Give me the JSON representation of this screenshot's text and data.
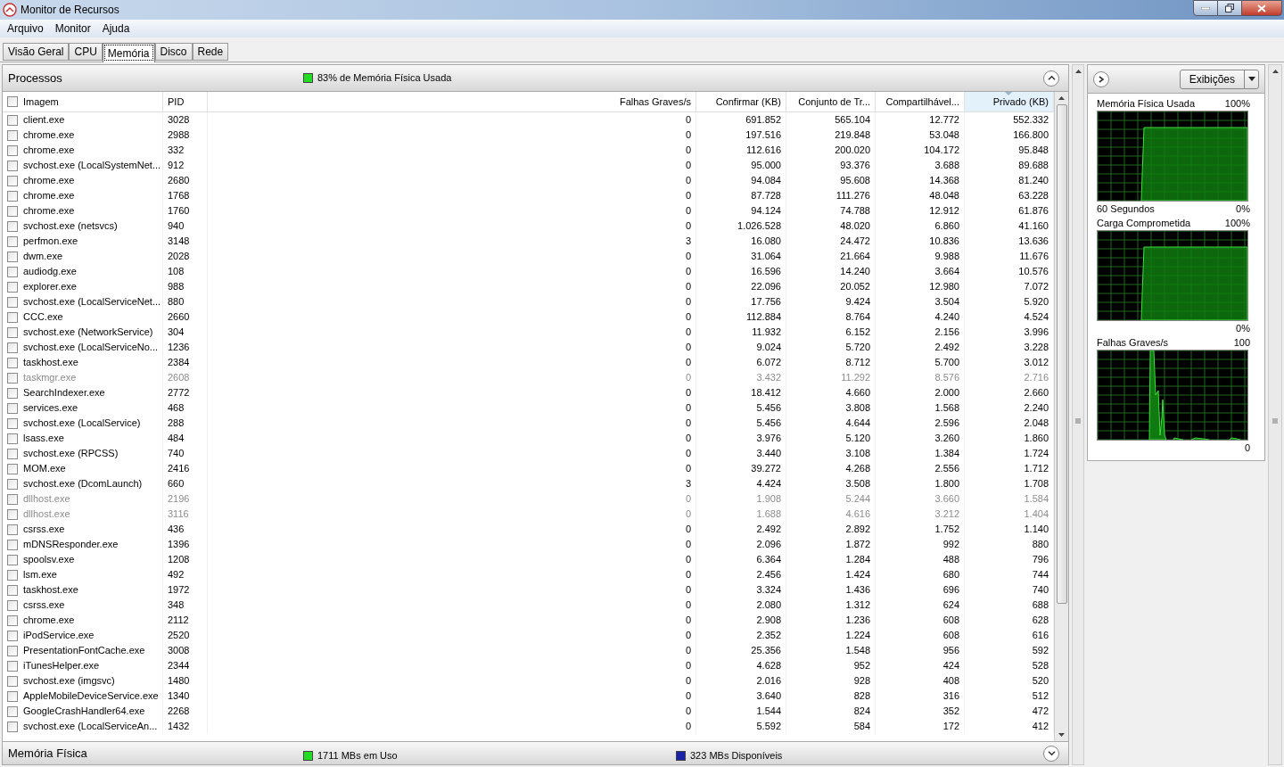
{
  "window": {
    "title": "Monitor de Recursos"
  },
  "menu": [
    {
      "label": "Arquivo"
    },
    {
      "label": "Monitor"
    },
    {
      "label": "Ajuda"
    }
  ],
  "tabs": [
    {
      "label": "Visão Geral",
      "selected": false
    },
    {
      "label": "CPU",
      "selected": false
    },
    {
      "label": "Memória",
      "selected": true
    },
    {
      "label": "Disco",
      "selected": false
    },
    {
      "label": "Rede",
      "selected": false
    }
  ],
  "processes": {
    "title": "Processos",
    "summary": "83% de Memória Física Usada",
    "expanded": true,
    "header_checked": false,
    "columns": [
      {
        "label": "Imagem",
        "sorted": false
      },
      {
        "label": "PID",
        "sorted": false
      },
      {
        "label": "Falhas Graves/s",
        "sorted": false
      },
      {
        "label": "Confirmar (KB)",
        "sorted": false
      },
      {
        "label": "Conjunto de Tr...",
        "sorted": false
      },
      {
        "label": "Compartilhável...",
        "sorted": false
      },
      {
        "label": "Privado (KB)",
        "sorted": true
      }
    ],
    "rows": [
      {
        "image": "client.exe",
        "pid": "3028",
        "faults": "0",
        "commit": "691.852",
        "working": "565.104",
        "shareable": "12.772",
        "private": "552.332",
        "terminated": false,
        "checked": false
      },
      {
        "image": "chrome.exe",
        "pid": "2988",
        "faults": "0",
        "commit": "197.516",
        "working": "219.848",
        "shareable": "53.048",
        "private": "166.800",
        "terminated": false,
        "checked": false
      },
      {
        "image": "chrome.exe",
        "pid": "332",
        "faults": "0",
        "commit": "112.616",
        "working": "200.020",
        "shareable": "104.172",
        "private": "95.848",
        "terminated": false,
        "checked": false
      },
      {
        "image": "svchost.exe (LocalSystemNet...",
        "pid": "912",
        "faults": "0",
        "commit": "95.000",
        "working": "93.376",
        "shareable": "3.688",
        "private": "89.688",
        "terminated": false,
        "checked": false
      },
      {
        "image": "chrome.exe",
        "pid": "2680",
        "faults": "0",
        "commit": "94.084",
        "working": "95.608",
        "shareable": "14.368",
        "private": "81.240",
        "terminated": false,
        "checked": false
      },
      {
        "image": "chrome.exe",
        "pid": "1768",
        "faults": "0",
        "commit": "87.728",
        "working": "111.276",
        "shareable": "48.048",
        "private": "63.228",
        "terminated": false,
        "checked": false
      },
      {
        "image": "chrome.exe",
        "pid": "1760",
        "faults": "0",
        "commit": "94.124",
        "working": "74.788",
        "shareable": "12.912",
        "private": "61.876",
        "terminated": false,
        "checked": false
      },
      {
        "image": "svchost.exe (netsvcs)",
        "pid": "940",
        "faults": "0",
        "commit": "1.026.528",
        "working": "48.020",
        "shareable": "6.860",
        "private": "41.160",
        "terminated": false,
        "checked": false
      },
      {
        "image": "perfmon.exe",
        "pid": "3148",
        "faults": "3",
        "commit": "16.080",
        "working": "24.472",
        "shareable": "10.836",
        "private": "13.636",
        "terminated": false,
        "checked": false
      },
      {
        "image": "dwm.exe",
        "pid": "2028",
        "faults": "0",
        "commit": "31.064",
        "working": "21.664",
        "shareable": "9.988",
        "private": "11.676",
        "terminated": false,
        "checked": false
      },
      {
        "image": "audiodg.exe",
        "pid": "108",
        "faults": "0",
        "commit": "16.596",
        "working": "14.240",
        "shareable": "3.664",
        "private": "10.576",
        "terminated": false,
        "checked": false
      },
      {
        "image": "explorer.exe",
        "pid": "988",
        "faults": "0",
        "commit": "22.096",
        "working": "20.052",
        "shareable": "12.980",
        "private": "7.072",
        "terminated": false,
        "checked": false
      },
      {
        "image": "svchost.exe (LocalServiceNet...",
        "pid": "880",
        "faults": "0",
        "commit": "17.756",
        "working": "9.424",
        "shareable": "3.504",
        "private": "5.920",
        "terminated": false,
        "checked": false
      },
      {
        "image": "CCC.exe",
        "pid": "2660",
        "faults": "0",
        "commit": "112.884",
        "working": "8.764",
        "shareable": "4.240",
        "private": "4.524",
        "terminated": false,
        "checked": false
      },
      {
        "image": "svchost.exe (NetworkService)",
        "pid": "304",
        "faults": "0",
        "commit": "11.932",
        "working": "6.152",
        "shareable": "2.156",
        "private": "3.996",
        "terminated": false,
        "checked": false
      },
      {
        "image": "svchost.exe (LocalServiceNo...",
        "pid": "1236",
        "faults": "0",
        "commit": "9.024",
        "working": "5.720",
        "shareable": "2.492",
        "private": "3.228",
        "terminated": false,
        "checked": false
      },
      {
        "image": "taskhost.exe",
        "pid": "2384",
        "faults": "0",
        "commit": "6.072",
        "working": "8.712",
        "shareable": "5.700",
        "private": "3.012",
        "terminated": false,
        "checked": false
      },
      {
        "image": "taskmgr.exe",
        "pid": "2608",
        "faults": "0",
        "commit": "3.432",
        "working": "11.292",
        "shareable": "8.576",
        "private": "2.716",
        "terminated": true,
        "checked": false
      },
      {
        "image": "SearchIndexer.exe",
        "pid": "2772",
        "faults": "0",
        "commit": "18.412",
        "working": "4.660",
        "shareable": "2.000",
        "private": "2.660",
        "terminated": false,
        "checked": false
      },
      {
        "image": "services.exe",
        "pid": "468",
        "faults": "0",
        "commit": "5.456",
        "working": "3.808",
        "shareable": "1.568",
        "private": "2.240",
        "terminated": false,
        "checked": false
      },
      {
        "image": "svchost.exe (LocalService)",
        "pid": "288",
        "faults": "0",
        "commit": "5.456",
        "working": "4.644",
        "shareable": "2.596",
        "private": "2.048",
        "terminated": false,
        "checked": false
      },
      {
        "image": "lsass.exe",
        "pid": "484",
        "faults": "0",
        "commit": "3.976",
        "working": "5.120",
        "shareable": "3.260",
        "private": "1.860",
        "terminated": false,
        "checked": false
      },
      {
        "image": "svchost.exe (RPCSS)",
        "pid": "740",
        "faults": "0",
        "commit": "3.440",
        "working": "3.108",
        "shareable": "1.384",
        "private": "1.724",
        "terminated": false,
        "checked": false
      },
      {
        "image": "MOM.exe",
        "pid": "2416",
        "faults": "0",
        "commit": "39.272",
        "working": "4.268",
        "shareable": "2.556",
        "private": "1.712",
        "terminated": false,
        "checked": false
      },
      {
        "image": "svchost.exe (DcomLaunch)",
        "pid": "660",
        "faults": "3",
        "commit": "4.424",
        "working": "3.508",
        "shareable": "1.800",
        "private": "1.708",
        "terminated": false,
        "checked": false
      },
      {
        "image": "dllhost.exe",
        "pid": "2196",
        "faults": "0",
        "commit": "1.908",
        "working": "5.244",
        "shareable": "3.660",
        "private": "1.584",
        "terminated": true,
        "checked": false
      },
      {
        "image": "dllhost.exe",
        "pid": "3116",
        "faults": "0",
        "commit": "1.688",
        "working": "4.616",
        "shareable": "3.212",
        "private": "1.404",
        "terminated": true,
        "checked": false
      },
      {
        "image": "csrss.exe",
        "pid": "436",
        "faults": "0",
        "commit": "2.492",
        "working": "2.892",
        "shareable": "1.752",
        "private": "1.140",
        "terminated": false,
        "checked": false
      },
      {
        "image": "mDNSResponder.exe",
        "pid": "1396",
        "faults": "0",
        "commit": "2.096",
        "working": "1.872",
        "shareable": "992",
        "private": "880",
        "terminated": false,
        "checked": false
      },
      {
        "image": "spoolsv.exe",
        "pid": "1208",
        "faults": "0",
        "commit": "6.364",
        "working": "1.284",
        "shareable": "488",
        "private": "796",
        "terminated": false,
        "checked": false
      },
      {
        "image": "lsm.exe",
        "pid": "492",
        "faults": "0",
        "commit": "2.456",
        "working": "1.424",
        "shareable": "680",
        "private": "744",
        "terminated": false,
        "checked": false
      },
      {
        "image": "taskhost.exe",
        "pid": "1972",
        "faults": "0",
        "commit": "3.324",
        "working": "1.436",
        "shareable": "696",
        "private": "740",
        "terminated": false,
        "checked": false
      },
      {
        "image": "csrss.exe",
        "pid": "348",
        "faults": "0",
        "commit": "2.080",
        "working": "1.312",
        "shareable": "624",
        "private": "688",
        "terminated": false,
        "checked": false
      },
      {
        "image": "chrome.exe",
        "pid": "2112",
        "faults": "0",
        "commit": "2.908",
        "working": "1.236",
        "shareable": "608",
        "private": "628",
        "terminated": false,
        "checked": false
      },
      {
        "image": "iPodService.exe",
        "pid": "2520",
        "faults": "0",
        "commit": "2.352",
        "working": "1.224",
        "shareable": "608",
        "private": "616",
        "terminated": false,
        "checked": false
      },
      {
        "image": "PresentationFontCache.exe",
        "pid": "3008",
        "faults": "0",
        "commit": "25.356",
        "working": "1.548",
        "shareable": "956",
        "private": "592",
        "terminated": false,
        "checked": false
      },
      {
        "image": "iTunesHelper.exe",
        "pid": "2344",
        "faults": "0",
        "commit": "4.628",
        "working": "952",
        "shareable": "424",
        "private": "528",
        "terminated": false,
        "checked": false
      },
      {
        "image": "svchost.exe (imgsvc)",
        "pid": "1480",
        "faults": "0",
        "commit": "2.016",
        "working": "928",
        "shareable": "408",
        "private": "520",
        "terminated": false,
        "checked": false
      },
      {
        "image": "AppleMobileDeviceService.exe",
        "pid": "1340",
        "faults": "0",
        "commit": "3.640",
        "working": "828",
        "shareable": "316",
        "private": "512",
        "terminated": false,
        "checked": false
      },
      {
        "image": "GoogleCrashHandler64.exe",
        "pid": "2268",
        "faults": "0",
        "commit": "1.544",
        "working": "824",
        "shareable": "352",
        "private": "472",
        "terminated": false,
        "checked": false
      },
      {
        "image": "svchost.exe (LocalServiceAn...",
        "pid": "1432",
        "faults": "0",
        "commit": "5.592",
        "working": "584",
        "shareable": "172",
        "private": "412",
        "terminated": false,
        "checked": false
      }
    ]
  },
  "physical_memory": {
    "title": "Memória Física",
    "expanded": false,
    "legend": [
      {
        "label": "1711 MBs em Uso",
        "color": "#22dd22"
      },
      {
        "label": "323 MBs Disponíveis",
        "color": "#1a22aa"
      }
    ]
  },
  "side_panel": {
    "views_button": "Exibições",
    "graphs": [
      {
        "title": "Memória Física Usada",
        "max": "100%",
        "min": "0%",
        "footer": "60 Segundos",
        "kind": "usage"
      },
      {
        "title": "Carga Comprometida",
        "max": "100%",
        "min": "0%",
        "kind": "usage"
      },
      {
        "title": "Falhas Graves/s",
        "max": "100",
        "min": "0",
        "kind": "spikes"
      }
    ]
  }
}
